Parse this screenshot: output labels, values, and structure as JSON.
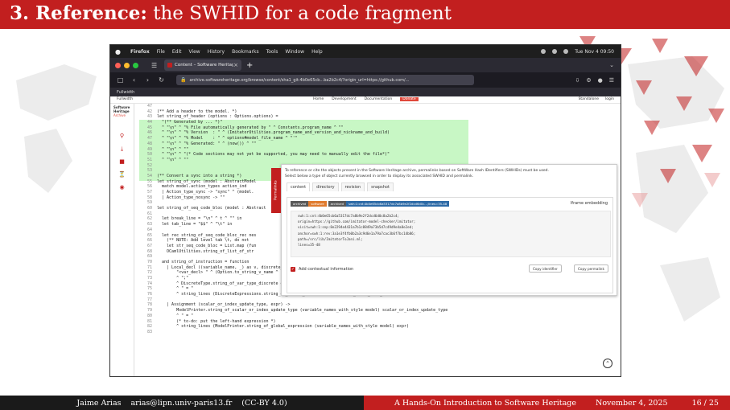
{
  "slide": {
    "title_bold": "3. Reference:",
    "title_rest": "the SWHID for a code fragment"
  },
  "footer": {
    "author": "Jaime Arias",
    "email": "arias@lipn.univ-paris13.fr",
    "license": "(CC-BY 4.0)",
    "talk": "A Hands-On Introduction to Software Heritage",
    "date": "November 4, 2025",
    "page": "16 / 25"
  },
  "colors": {
    "accent": "#c21f1f",
    "code_highlight": "#c8f7c5",
    "footer_dark": "#1a1a1a"
  },
  "browser": {
    "menubar": [
      "Firefox",
      "File",
      "Edit",
      "View",
      "History",
      "Bookmarks",
      "Tools",
      "Window",
      "Help"
    ],
    "clock": "Tue Nov 4  09:50",
    "tab_title": "Content – Software Heritage",
    "url": "archive.softwareheritage.org/browse/content/sha1_git:4b0e65cb...ba2b2c4/?origin_url=https://github.com/...",
    "bookmark": "Fullwidth"
  },
  "swh": {
    "sidebar_toggle": "Fullwidth",
    "logo": "Software Heritage",
    "logo_sub": "Archive",
    "nav_links": [
      "Home",
      "Development",
      "Documentation"
    ],
    "donate": "Donate",
    "right_links": [
      "Standalone",
      "login"
    ]
  },
  "code_lines": [
    {
      "n": "47",
      "t": ""
    },
    {
      "n": "42",
      "t": "(** Add a header to the model. *)"
    },
    {
      "n": "43",
      "t": "let string_of_header (options : Options.options) ="
    },
    {
      "n": "44",
      "t": "  \"(** Generated by ... *)\""
    },
    {
      "n": "45",
      "t": "  ^ \"\\n\" ^ \"% File automatically generated by \" ^ Constants.program_name ^ \"\""
    },
    {
      "n": "46",
      "t": "  ^ \"\\n\" ^ \"% Version  : \" ^ (ImitatorUtilities.program_name_and_version_and_nickname_and_build)"
    },
    {
      "n": "47",
      "t": "  ^ \"\\n\" ^ \"% Model    : \" ^ options#model_file_name ^ \"'\""
    },
    {
      "n": "48",
      "t": "  ^ \"\\n\" ^ \"% Generated: \" ^ (now()) ^ \"\""
    },
    {
      "n": "49",
      "t": "  ^ \"\\n\" ^ \"\""
    },
    {
      "n": "50",
      "t": "  ^ \"\\n\" ^ \"(* Code sections may not yet be supported, you may need to manually edit the file*)\""
    },
    {
      "n": "51",
      "t": "  ^ \"\\n\" ^ \"\""
    },
    {
      "n": "52",
      "t": ""
    },
    {
      "n": "53",
      "t": ""
    },
    {
      "n": "54",
      "t": "(** Convert a sync into a string *)"
    },
    {
      "n": "55",
      "t": "let string_of_sync (model : AbstractModel"
    },
    {
      "n": "56",
      "t": "  match model.action_types action_ind"
    },
    {
      "n": "57",
      "t": "  | Action_type_sync -> \"sync\" ^ (model."
    },
    {
      "n": "58",
      "t": "  | Action_type_nosync -> \"\""
    },
    {
      "n": "59",
      "t": ""
    },
    {
      "n": "60",
      "t": "let string_of_seq_code_bloc (model : Abstract"
    },
    {
      "n": "61",
      "t": ""
    },
    {
      "n": "62",
      "t": "  let break_line = \"\\n\" ^ t ^ \"\" in"
    },
    {
      "n": "63",
      "t": "  let tab_line = \"$$\" ^ \"\\t\" in"
    },
    {
      "n": "64",
      "t": ""
    },
    {
      "n": "65",
      "t": "  let rec string_of_seq_code_bloc_rec nes"
    },
    {
      "n": "66",
      "t": "    (** NOTE: Add level tab \\t, do not"
    },
    {
      "n": "67",
      "t": "    let str_seq_code_bloc = List.map (fun"
    },
    {
      "n": "68",
      "t": "    OCamlUtilities.string_of_list_of_str"
    },
    {
      "n": "69",
      "t": ""
    },
    {
      "n": "70",
      "t": "  and string_of_instruction = function"
    },
    {
      "n": "71",
      "t": "    | Local_decl ((variable_name, _) as v, discrete_type, expr) ->"
    },
    {
      "n": "72",
      "t": "        \"<var_decl> \" ^ (Option.to_string_v_name ^ \"\")\""
    },
    {
      "n": "73",
      "t": "        ^ \";\""
    },
    {
      "n": "74",
      "t": "        ^ DiscreteType.string_of_var_type_discrete discrete_type"
    },
    {
      "n": "75",
      "t": "        ^ \" = \""
    },
    {
      "n": "76",
      "t": "        ^ string_lines (DiscreteExpressions.string_of_global_expression (variable_names_with_style model) expr)"
    },
    {
      "n": "77",
      "t": ""
    },
    {
      "n": "78",
      "t": "    | Assignment (scalar_or_index_update_type, expr) ->"
    },
    {
      "n": "79",
      "t": "        ModelPrinter.string_of_scalar_or_index_update_type (variable_names_with_style model) scalar_or_index_update_type"
    },
    {
      "n": "80",
      "t": "        ^ \" = \""
    },
    {
      "n": "81",
      "t": "        (* to-do: put the left-hand expression *)"
    },
    {
      "n": "82",
      "t": "        ^ string_lines (ModelPrinter.string_of_global_expression (variable_names_with_style model) expr)"
    },
    {
      "n": "83",
      "t": ""
    }
  ],
  "permalink_panel": {
    "vertical_tab": "Permalinks",
    "intro_1": "To reference or cite the objects present in the Software Heritage archive, permalinks based on SoftWare Hash IDentifiers (SWHIDs) must be used.",
    "intro_2": "Select below a type of object currently browsed in order to display its associated SWHID and permalink.",
    "tabs": [
      "content",
      "directory",
      "revision",
      "snapshot"
    ],
    "badge_a": "archived",
    "badge_b": "software",
    "badge_c": "archived",
    "badge_d": "swh:1:cnt:4b0e65cb6a5317dc7a8b9e2f2dcd6d0c...;lines=35-48",
    "iframe_label": "Iframe embedding",
    "swhid_lines": [
      "swh:1:cnt:4b0e65cb6a5317dc7a8b9e2f2dcd6d0c8a2b2c4;",
      "origin=https://github.com/imitator-model-checker/imitator;",
      "visit=swh:1:snp:8e2294e4431a7b1c8849a73b5d7c49d9e4a8e2ed;",
      "anchor=swh:1:rev:3a1e3f4fb0b2a3c9d6e1a79a7cac3b6f7bc14b86;",
      "path=/src/lib/ImitatorToJani.ml;",
      "lines=35-48"
    ],
    "context_label": "Add contextual information",
    "btn_copy_id": "Copy identifier",
    "btn_copy_link": "Copy permalink"
  }
}
